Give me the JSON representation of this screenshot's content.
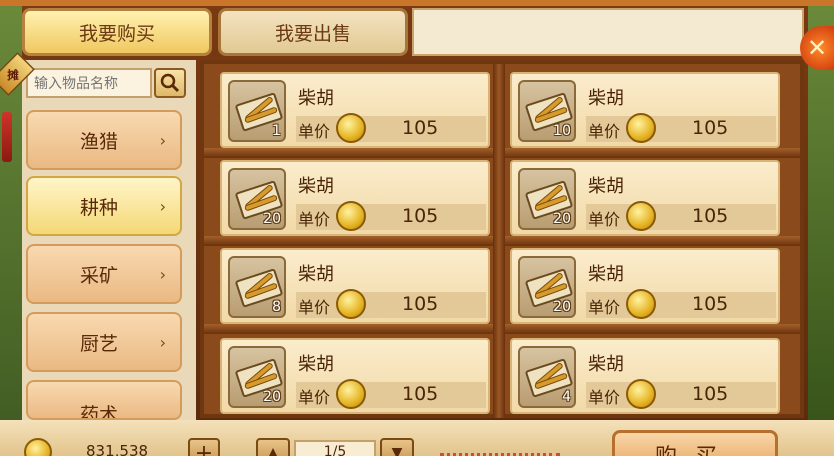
{
  "tabs": {
    "buy_label": "我要购买",
    "sell_label": "我要出售"
  },
  "badge_text": "摊",
  "search": {
    "placeholder": "输入物品名称"
  },
  "categories": [
    {
      "label": "渔猎",
      "active": false
    },
    {
      "label": "耕种",
      "active": true
    },
    {
      "label": "采矿",
      "active": false
    },
    {
      "label": "厨艺",
      "active": false
    },
    {
      "label": "药术",
      "active": false
    }
  ],
  "items": [
    {
      "name": "柴胡",
      "qty": "1",
      "price_label": "单价",
      "price": "105"
    },
    {
      "name": "柴胡",
      "qty": "10",
      "price_label": "单价",
      "price": "105"
    },
    {
      "name": "柴胡",
      "qty": "20",
      "price_label": "单价",
      "price": "105"
    },
    {
      "name": "柴胡",
      "qty": "20",
      "price_label": "单价",
      "price": "105"
    },
    {
      "name": "柴胡",
      "qty": "8",
      "price_label": "单价",
      "price": "105"
    },
    {
      "name": "柴胡",
      "qty": "20",
      "price_label": "单价",
      "price": "105"
    },
    {
      "name": "柴胡",
      "qty": "20",
      "price_label": "单价",
      "price": "105"
    },
    {
      "name": "柴胡",
      "qty": "4",
      "price_label": "单价",
      "price": "105"
    }
  ],
  "footer": {
    "balance": "831,538",
    "plus": "+",
    "page": "1/5",
    "buy_label": "购买"
  },
  "colors": {
    "gold": "#e5b323",
    "frame": "#7a3a12",
    "parchment": "#fbeccb"
  }
}
